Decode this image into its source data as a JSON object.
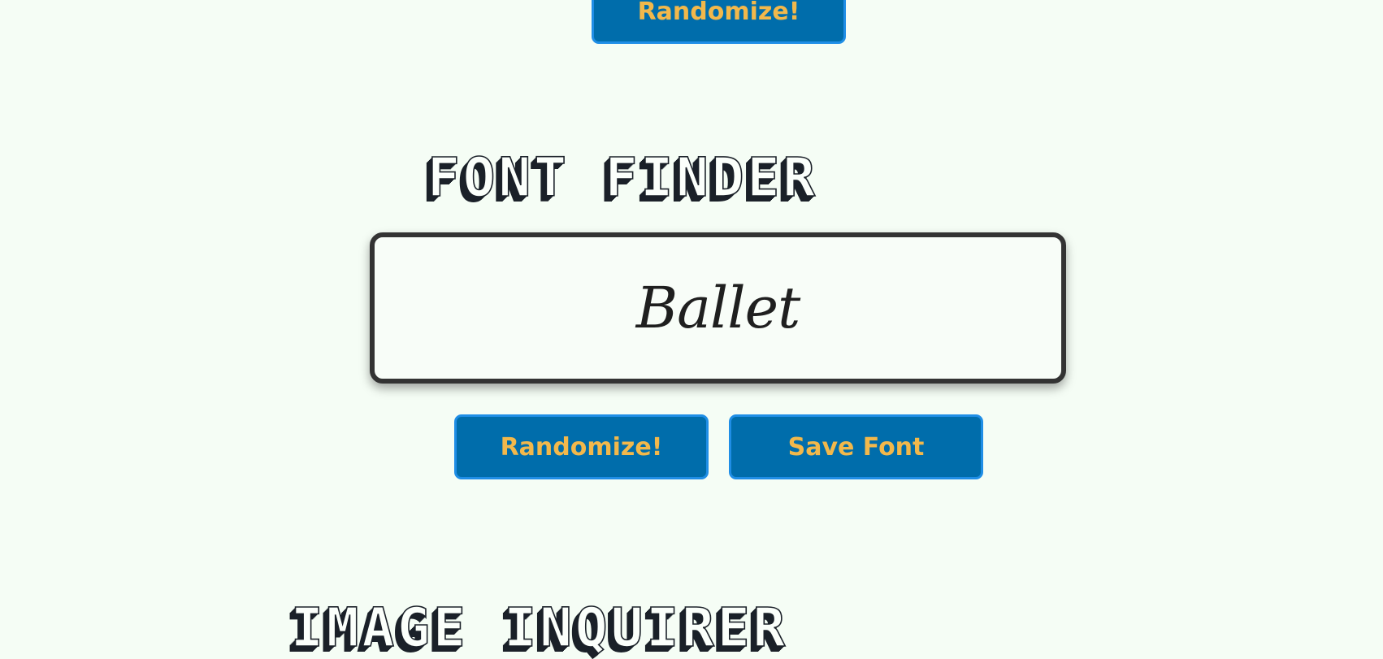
{
  "top_button": {
    "label": "Randomize!"
  },
  "font_finder": {
    "title": "FONT FINDER",
    "preview_text": "Ballet",
    "randomize_label": "Randomize!",
    "save_label": "Save Font"
  },
  "image_inquirer": {
    "title": "IMAGE INQUIRER"
  },
  "colors": {
    "background": "#f5fdf5",
    "button_bg": "#006dab",
    "button_border": "#1f8ee6",
    "button_text": "#f2b84b",
    "box_border": "#333333"
  }
}
